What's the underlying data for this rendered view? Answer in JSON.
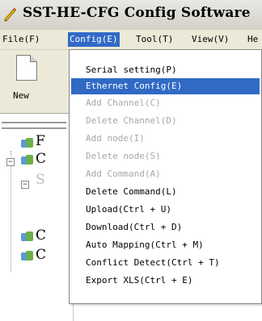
{
  "window": {
    "title": "SST-HE-CFG Config Software"
  },
  "menubar": {
    "items": [
      {
        "label": "File(F)"
      },
      {
        "label": "Config(E)"
      },
      {
        "label": "Tool(T)"
      },
      {
        "label": "View(V)"
      },
      {
        "label": "He"
      }
    ]
  },
  "toolbar": {
    "new_label": "New"
  },
  "tree": {
    "letters": [
      "F",
      "C",
      "S",
      "C",
      "C"
    ]
  },
  "config_menu": {
    "items": [
      {
        "label": "Serial setting(P)",
        "enabled": true
      },
      {
        "label": "Ethernet Config(E)",
        "enabled": true,
        "highlighted": true
      },
      {
        "label": "Add Channel(C)",
        "enabled": false
      },
      {
        "label": "Delete Channel(D)",
        "enabled": false
      },
      {
        "label": "Add node(I)",
        "enabled": false
      },
      {
        "label": "Delete node(S)",
        "enabled": false
      },
      {
        "label": "Add Command(A)",
        "enabled": false
      },
      {
        "label": "Delete Command(L)",
        "enabled": true
      },
      {
        "label": "Upload(Ctrl + U)",
        "enabled": true
      },
      {
        "label": "Download(Ctrl + D)",
        "enabled": true
      },
      {
        "label": "Auto Mapping(Ctrl + M)",
        "enabled": true
      },
      {
        "label": "Conflict Detect(Ctrl + T)",
        "enabled": true
      },
      {
        "label": "Export XLS(Ctrl + E)",
        "enabled": true
      }
    ]
  },
  "colors": {
    "menu_highlight": "#316ac5",
    "disabled_text": "#a7a6aa",
    "menubar_bg": "#ece9d8"
  }
}
